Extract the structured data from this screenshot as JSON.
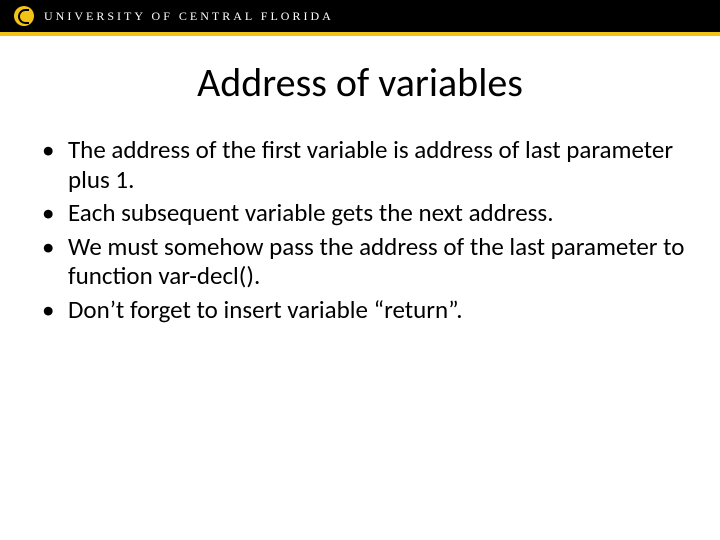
{
  "header": {
    "university": "UNIVERSITY OF CENTRAL FLORIDA"
  },
  "slide": {
    "title": "Address of variables",
    "bullets": [
      "The address of the first variable is address of last parameter plus 1.",
      "Each subsequent variable gets the next address.",
      "We must somehow pass the address of the last parameter to function var-decl().",
      "Don’t forget to insert variable “return”."
    ]
  }
}
